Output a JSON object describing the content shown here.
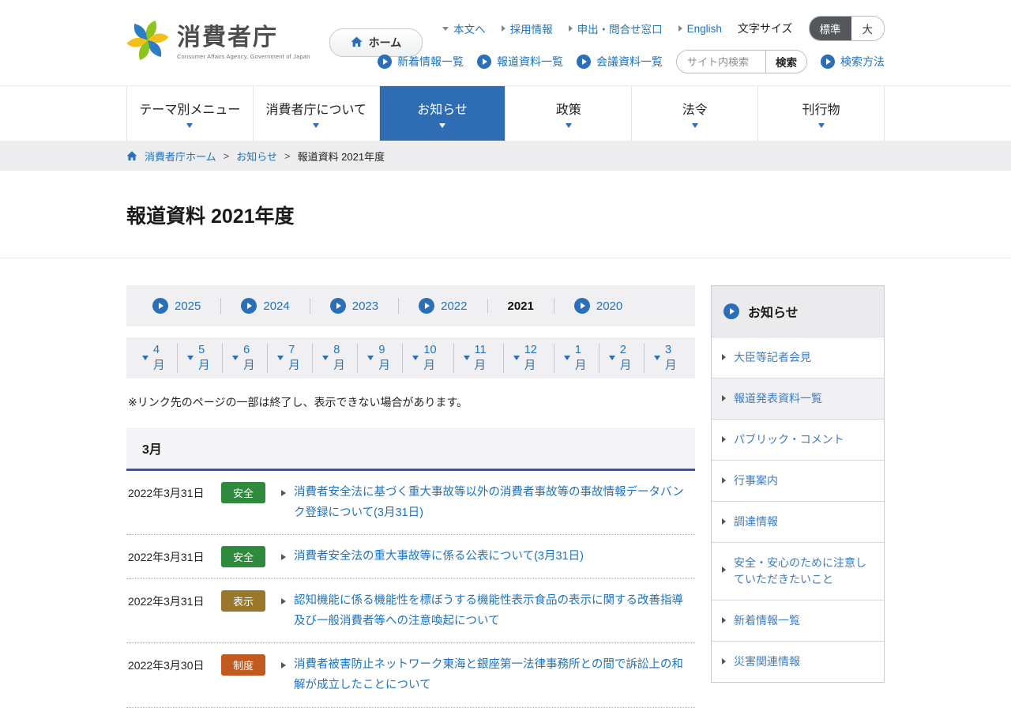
{
  "brand": {
    "title": "消費者庁",
    "subtitle": "Consumer Affairs Agency, Government of Japan",
    "home_button": "ホーム"
  },
  "utility": {
    "skip_link": "本文へ",
    "links": [
      {
        "label": "採用情報"
      },
      {
        "label": "申出・問合せ窓口"
      },
      {
        "label": "English"
      }
    ],
    "font_size_label": "文字サイズ",
    "font_size_standard": "標準",
    "font_size_large": "大",
    "quick_links": [
      {
        "label": "新着情報一覧"
      },
      {
        "label": "報道資料一覧"
      },
      {
        "label": "会議資料一覧"
      }
    ],
    "search_placeholder": "サイト内検索",
    "search_button": "検索",
    "search_help": "検索方法"
  },
  "nav": {
    "items": [
      {
        "label": "テーマ別メニュー",
        "active": false
      },
      {
        "label": "消費者庁について",
        "active": false
      },
      {
        "label": "お知らせ",
        "active": true
      },
      {
        "label": "政策",
        "active": false
      },
      {
        "label": "法令",
        "active": false
      },
      {
        "label": "刊行物",
        "active": false
      }
    ]
  },
  "breadcrumb": {
    "home": "消費者庁ホーム",
    "separator": ">",
    "items": [
      {
        "label": "お知らせ"
      },
      {
        "label": "報道資料 2021年度"
      }
    ]
  },
  "page": {
    "title": "報道資料 2021年度"
  },
  "years": {
    "items": [
      {
        "label": "2025",
        "current": false
      },
      {
        "label": "2024",
        "current": false
      },
      {
        "label": "2023",
        "current": false
      },
      {
        "label": "2022",
        "current": false
      },
      {
        "label": "2021",
        "current": true
      },
      {
        "label": "2020",
        "current": false
      }
    ]
  },
  "months": {
    "items": [
      {
        "label": "4月"
      },
      {
        "label": "5月"
      },
      {
        "label": "6月"
      },
      {
        "label": "7月"
      },
      {
        "label": "8月"
      },
      {
        "label": "9月"
      },
      {
        "label": "10月"
      },
      {
        "label": "11月"
      },
      {
        "label": "12月"
      },
      {
        "label": "1月"
      },
      {
        "label": "2月"
      },
      {
        "label": "3月"
      }
    ]
  },
  "notice": "※リンク先のページの一部は終了し、表示できない場合があります。",
  "section": {
    "heading": "3月"
  },
  "news": {
    "items": [
      {
        "date": "2022年3月31日",
        "badge": "安全",
        "title": "消費者安全法に基づく重大事故等以外の消費者事故等の事故情報データバンク登録について(3月31日)"
      },
      {
        "date": "2022年3月31日",
        "badge": "安全",
        "title": "消費者安全法の重大事故等に係る公表について(3月31日)"
      },
      {
        "date": "2022年3月31日",
        "badge": "表示",
        "title": "認知機能に係る機能性を標ぼうする機能性表示食品の表示に関する改善指導及び一般消費者等への注意喚起について"
      },
      {
        "date": "2022年3月30日",
        "badge": "制度",
        "title": "消費者被害防止ネットワーク東海と銀座第一法律事務所との間で訴訟上の和解が成立したことについて"
      }
    ]
  },
  "sidebar": {
    "heading": "お知らせ",
    "items": [
      {
        "label": "大臣等記者会見",
        "current": false
      },
      {
        "label": "報道発表資料一覧",
        "current": true
      },
      {
        "label": "パブリック・コメント",
        "current": false
      },
      {
        "label": "行事案内",
        "current": false
      },
      {
        "label": "調達情報",
        "current": false
      },
      {
        "label": "安全・安心のために注意していただきたいこと",
        "current": false
      },
      {
        "label": "新着情報一覧",
        "current": false
      },
      {
        "label": "災害関連情報",
        "current": false
      }
    ]
  },
  "colors": {
    "link_blue": "#1d73be",
    "accent_blue": "#2a6fb7",
    "nav_active_bg": "#2e6db4",
    "badge_safety_green": "#2e8a3c",
    "badge_labeling_brown": "#99782c",
    "badge_system_orange": "#c05a1e",
    "section_border_blue": "#39569d",
    "toggle_selected_dark": "#54585c",
    "logo_blue": "#2e7cc3",
    "logo_green": "#8dc21f",
    "logo_yellow": "#f3c018"
  },
  "icons": {
    "home_icon": "⌂",
    "play_circle_icon": "▶",
    "triangle_down_icon": "▼",
    "triangle_right_icon": "▶"
  }
}
